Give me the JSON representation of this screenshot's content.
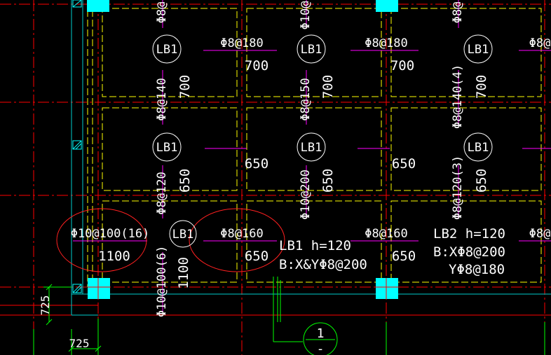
{
  "colors": {
    "background": "#000000",
    "axis": "#ff0000",
    "beam": "#ffff00",
    "rebar_mark": "#ff00ff",
    "column": "#00ffff",
    "dimension": "#00ff00",
    "text": "#ffffff",
    "wall_edge": "#00cccc",
    "revision_cloud": "#ff2020"
  },
  "panel_tags": [
    "LB1",
    "LB1",
    "LB1",
    "LB1",
    "LB1",
    "LB1",
    "LB1"
  ],
  "rebar_labels": {
    "top_center": "Φ8@180",
    "top_right": "Φ8@180",
    "top_edge": "Φ8@",
    "v_left_top": "Φ8@140",
    "v_mid_top": "Φ8@150",
    "v_right_top": "Φ8@140(4)",
    "v_left_mid": "Φ8@120",
    "v_mid_mid": "Φ10@200",
    "v_right_mid": "Φ8@120(3)",
    "v_left_top_cut": "Φ8@",
    "v_mid_top_cut": "Φ10@",
    "v_right_top_cut": "Φ8@",
    "bottom_left_circled": "Φ10@100(16)",
    "bottom_left_v": "Φ10@100(6)",
    "bottom_center_circled": "Φ8@160",
    "bottom_center2": "Φ8@160",
    "bottom_edge": "Φ8@"
  },
  "lengths": {
    "t1": "700",
    "t2": "700",
    "v1": "700",
    "v2": "700",
    "v3": "700",
    "m1": "650",
    "m2": "650",
    "m3": "650",
    "m4": "650",
    "m5": "650",
    "b1": "1100",
    "b2": "1100",
    "b3": "650",
    "b4": "650"
  },
  "notes": {
    "lb1_title": "LB1 h=120",
    "lb1_rebar": "B:X&YΦ8@200",
    "lb2_title": "LB2 h=120",
    "lb2_rebar_x": "B:XΦ8@200",
    "lb2_rebar_y": "YΦ8@180"
  },
  "dimensions": {
    "vertical": "725",
    "horizontal": "725"
  },
  "axis_bubble": {
    "top": "1",
    "bottom": "-"
  }
}
